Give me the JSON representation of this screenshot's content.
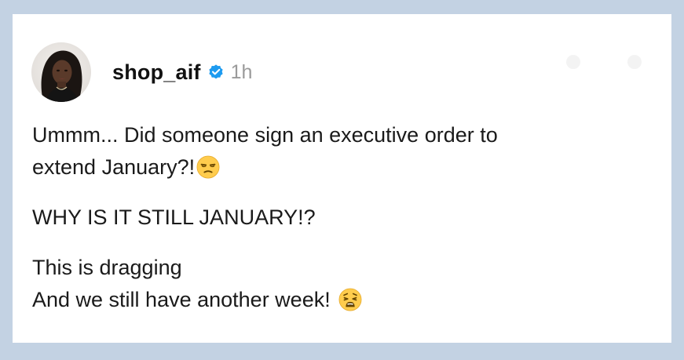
{
  "post": {
    "username": "shop_aif",
    "timestamp": "1h",
    "verified_icon": "verified-badge-icon",
    "avatar_icon": "profile-photo",
    "paragraphs": {
      "p1_line1": "Ummm... Did someone sign an executive order to",
      "p1_line2": "extend January?!",
      "p1_emoji": "unamused-face-icon",
      "p2_line1": "WHY IS IT STILL JANUARY!?",
      "p3_line1": "This is dragging",
      "p3_line2": "And we still have another week!",
      "p3_emoji": "weary-face-icon"
    }
  },
  "colors": {
    "background": "#c3d2e3",
    "card": "#ffffff",
    "text": "#1a1a1a",
    "verified_blue": "#1d9bf0",
    "timestamp_gray": "#9a9a9a"
  }
}
